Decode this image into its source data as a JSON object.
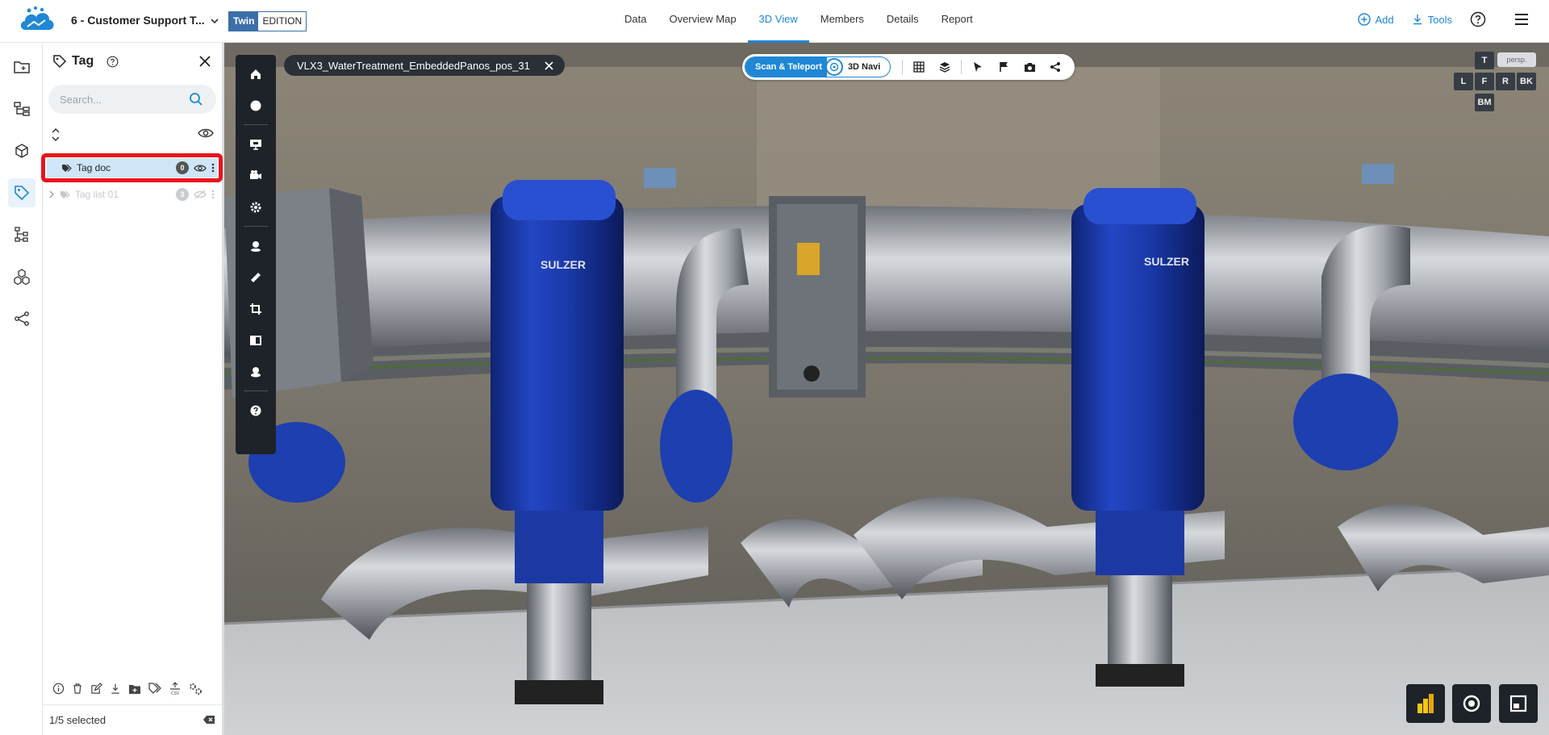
{
  "header": {
    "project_name": "6 - Customer Support T...",
    "edition_twin": "Twin",
    "edition_label": "EDITION",
    "tabs": [
      {
        "label": "Data"
      },
      {
        "label": "Overview Map"
      },
      {
        "label": "3D View",
        "active": true
      },
      {
        "label": "Members"
      },
      {
        "label": "Details"
      },
      {
        "label": "Report"
      }
    ],
    "add_label": "Add",
    "tools_label": "Tools"
  },
  "rail": {
    "items": [
      "folder-icon",
      "hierarchy-icon",
      "cube-icon",
      "tag-icon",
      "tree-icon",
      "components-icon",
      "share-icon"
    ],
    "active": "tag-icon"
  },
  "panel": {
    "title": "Tag",
    "search_placeholder": "Search...",
    "tags": [
      {
        "label": "Tag doc",
        "count": "0",
        "selected": true
      },
      {
        "label": "Tag list 01",
        "count": "3",
        "selected": false
      }
    ],
    "selection_status": "1/5 selected"
  },
  "viewer": {
    "document_name": "VLX3_WaterTreatment_EmbeddedPanos_pos_31",
    "nav_mode_on": "Scan & Teleport",
    "nav_mode_off": "3D Navi",
    "view_cube": {
      "top": "T",
      "left": "L",
      "front": "F",
      "right": "R",
      "back": "BK",
      "bottom": "BM",
      "projection": "persp."
    },
    "scene_labels": {
      "pump_brand_1": "SULZER",
      "pump_brand_2": "SULZER"
    }
  },
  "colors": {
    "accent": "#1f87d6",
    "highlight_border": "#e8151b",
    "toolbar_dark": "#1e2329",
    "pump_blue": "#1d3fb0"
  }
}
